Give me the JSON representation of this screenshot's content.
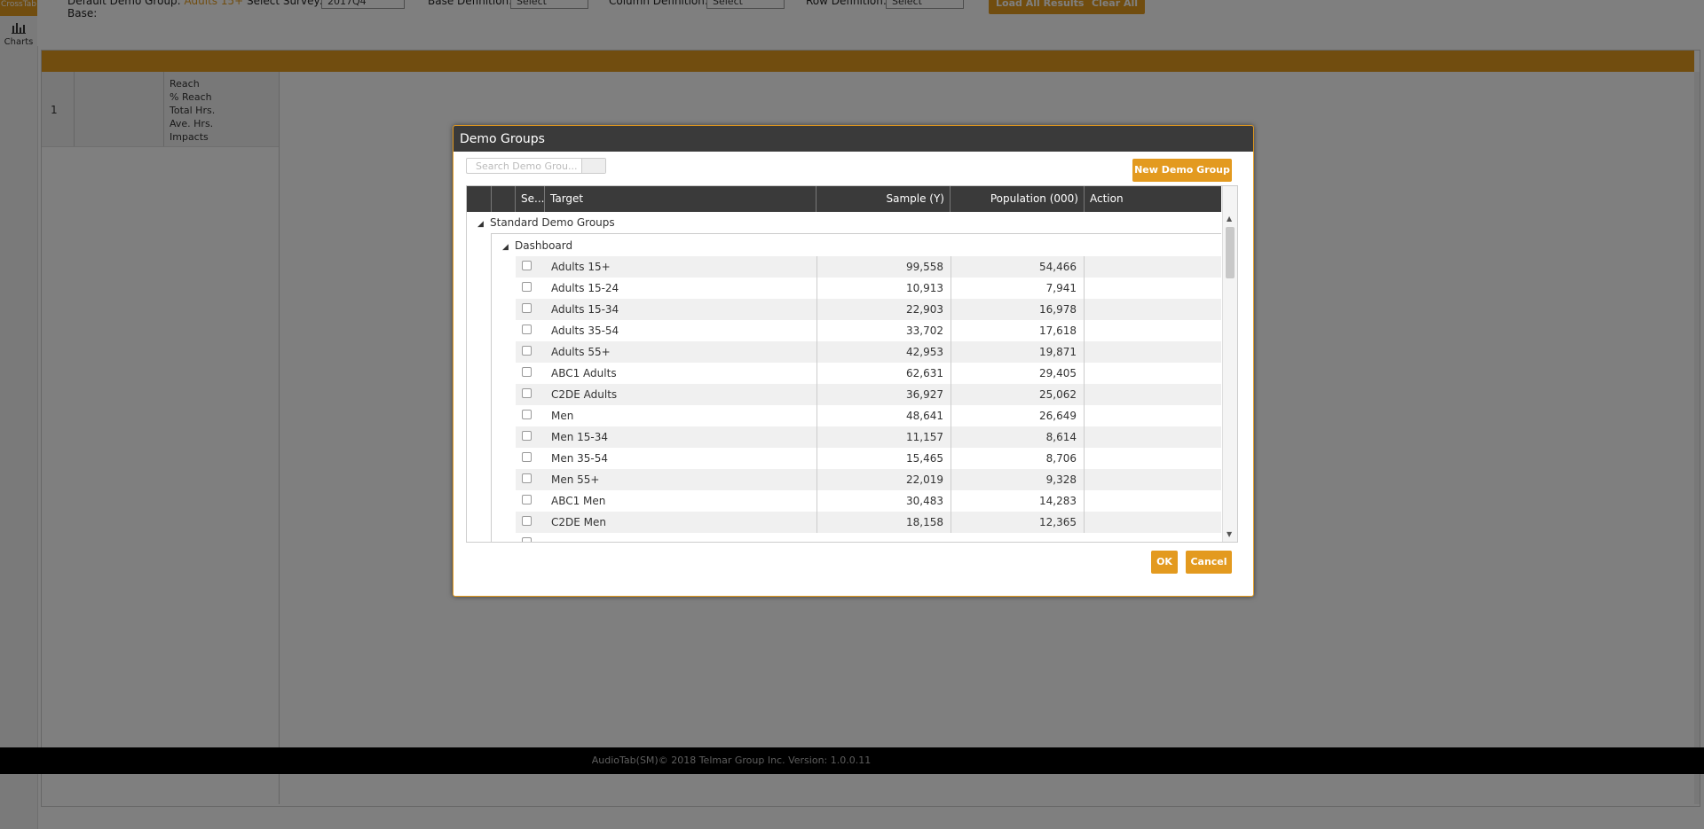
{
  "nav": {
    "tab_label": "CrossTab",
    "charts_label": "Charts"
  },
  "topbar": {
    "demo_group_label": "Default Demo Group:",
    "demo_group_value": "Adults 15+",
    "base_label": "Base:",
    "survey_label": "Select Survey:",
    "survey_value": "2017Q4",
    "base_def_label": "Base Definition:",
    "base_def_value": "Select",
    "column_def_label": "Column Definition:",
    "column_def_value": "Select",
    "row_def_label": "Row Definition:",
    "row_def_value": "Select",
    "load_all_label": "Load All Results",
    "clear_all_label": "Clear All"
  },
  "grid": {
    "row_number": "1",
    "measures": [
      "Reach",
      "% Reach",
      "Total Hrs.",
      "Ave. Hrs.",
      "Impacts"
    ]
  },
  "footer": {
    "text": "AudioTab(SM)© 2018 Telmar Group Inc. Version: 1.0.0.11"
  },
  "modal": {
    "title": "Demo Groups",
    "search_placeholder": "Search Demo Grou...",
    "new_button": "New Demo Group",
    "columns": {
      "select": "Se...",
      "target": "Target",
      "sample": "Sample (Y)",
      "population": "Population (000)",
      "action": "Action"
    },
    "group_label": "Standard Demo Groups",
    "subgroup_label": "Dashboard",
    "rows": [
      {
        "target": "Adults 15+",
        "sample": "99,558",
        "population": "54,466"
      },
      {
        "target": "Adults 15-24",
        "sample": "10,913",
        "population": "7,941"
      },
      {
        "target": "Adults 15-34",
        "sample": "22,903",
        "population": "16,978"
      },
      {
        "target": "Adults 35-54",
        "sample": "33,702",
        "population": "17,618"
      },
      {
        "target": "Adults 55+",
        "sample": "42,953",
        "population": "19,871"
      },
      {
        "target": "ABC1 Adults",
        "sample": "62,631",
        "population": "29,405"
      },
      {
        "target": "C2DE Adults",
        "sample": "36,927",
        "population": "25,062"
      },
      {
        "target": "Men",
        "sample": "48,641",
        "population": "26,649"
      },
      {
        "target": "Men 15-34",
        "sample": "11,157",
        "population": "8,614"
      },
      {
        "target": "Men 35-54",
        "sample": "15,465",
        "population": "8,706"
      },
      {
        "target": "Men 55+",
        "sample": "22,019",
        "population": "9,328"
      },
      {
        "target": "ABC1 Men",
        "sample": "30,483",
        "population": "14,283"
      },
      {
        "target": "C2DE Men",
        "sample": "18,158",
        "population": "12,365"
      }
    ],
    "ok_label": "OK",
    "cancel_label": "Cancel"
  },
  "colors": {
    "accent": "#e39a1f",
    "header_dark": "#3a3a3a"
  }
}
